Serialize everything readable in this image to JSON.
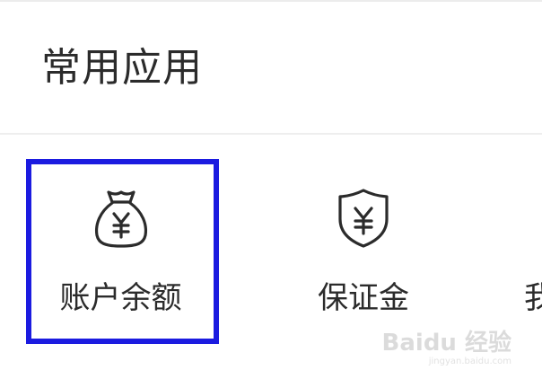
{
  "section": {
    "title": "常用应用"
  },
  "apps": [
    {
      "label": "账户余额",
      "icon": "money-bag-yen-icon",
      "selected": true
    },
    {
      "label": "保证金",
      "icon": "shield-yen-icon",
      "selected": false
    },
    {
      "label": "我",
      "icon": "",
      "selected": false
    }
  ],
  "watermark": {
    "text": "Baidu 经验",
    "domain": "jingyan.baidu.com"
  },
  "colors": {
    "highlight": "#1b1be0",
    "text": "#2b2b2b",
    "icon_stroke": "#2b2b2b"
  }
}
